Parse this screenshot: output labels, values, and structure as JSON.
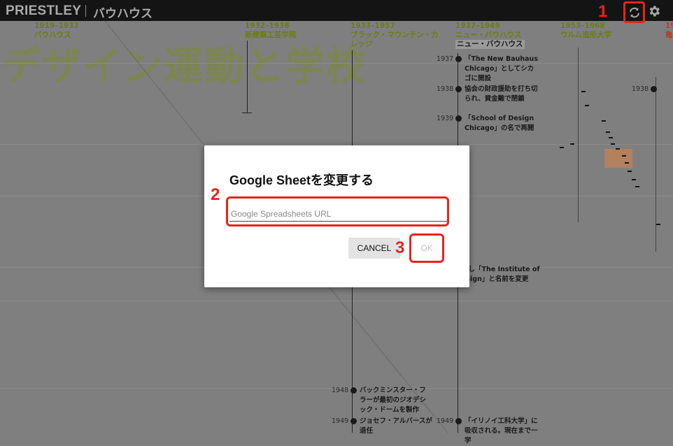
{
  "header": {
    "logo": "PRIESTLEY",
    "project_title": "バウハウス"
  },
  "icons": {
    "sync": "sync-icon",
    "settings": "gear-icon"
  },
  "colors": {
    "annotation_red": "#e8241b",
    "dialog_bg": "#ffffff",
    "overlay": "#7f7f7f"
  },
  "annotations": {
    "step1": "1",
    "step2": "2",
    "step3": "3"
  },
  "timeline": {
    "big_title": "デザイン運動と学校",
    "columns": [
      {
        "years": "1919–1933",
        "name": "バウハウス"
      },
      {
        "years": "1932–1938",
        "name": "新建築工芸学院"
      },
      {
        "years": "1933–1957",
        "name": "ブラック・マウンテン・カレッジ"
      },
      {
        "years": "1937–1949",
        "name": "ニュー・バウハウス",
        "label": "ニュー・バウハウス"
      },
      {
        "years": "1953–1968",
        "name": "ウルム造形大学"
      },
      {
        "years": "19",
        "name": "亀"
      }
    ],
    "events": [
      {
        "year": "1937",
        "text": "「The New Bauhaus Chicago」としてシカゴに開設"
      },
      {
        "year": "1938",
        "text": "協会の財政援助を打ち切られ、資金難で閉鎖"
      },
      {
        "year": "1939",
        "text": "「School of Design Chicago」の名で再開"
      },
      {
        "year": "",
        "text": "大し「The Institute of esign」と名前を変更"
      },
      {
        "year": "1948",
        "text": "バックミンスター・フラーが最初のジオデシック・ドームを製作"
      },
      {
        "year": "1949",
        "text": "ジョセフ・アルバースが退任"
      },
      {
        "year": "1949",
        "text": "「イリノイ工科大学」に吸収される。現在まで一学"
      },
      {
        "year": "1938",
        "text": ""
      }
    ]
  },
  "dialog": {
    "title": "Google Sheetを変更する",
    "url_input": {
      "value": "",
      "placeholder": "Google Spreadsheets URL"
    },
    "cancel_label": "CANCEL",
    "ok_label": "OK"
  }
}
